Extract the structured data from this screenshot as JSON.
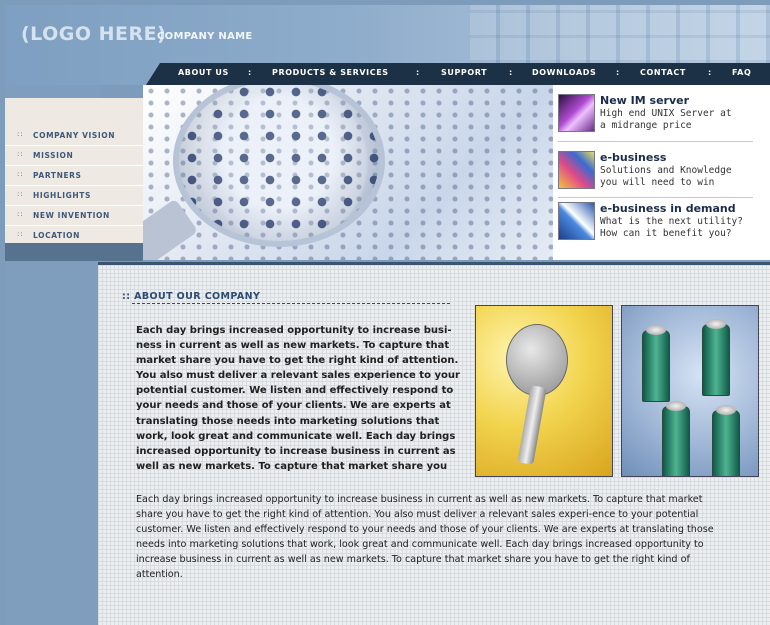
{
  "header": {
    "logo": "(LOGO HERE)",
    "company_name": "COMPANY NAME"
  },
  "nav": {
    "items": [
      {
        "label": "ABOUT US"
      },
      {
        "label": "PRODUCTS & SERVICES"
      },
      {
        "label": "SUPPORT"
      },
      {
        "label": "DOWNLOADS"
      },
      {
        "label": "CONTACT"
      },
      {
        "label": "FAQ"
      }
    ],
    "separator": ":"
  },
  "sidebar": {
    "bullet": "::",
    "items": [
      {
        "label": "COMPANY VISION"
      },
      {
        "label": "MISSION"
      },
      {
        "label": "PARTNERS"
      },
      {
        "label": "HIGHLIGHTS"
      },
      {
        "label": "NEW INVENTION"
      },
      {
        "label": "LOCATION"
      }
    ]
  },
  "promos": [
    {
      "title": "New IM   server",
      "desc": "High end UNIX Server at\na midrange price",
      "icon": "server-thumbnail"
    },
    {
      "title": "e-business",
      "desc": "Solutions and Knowledge\nyou will need to win",
      "icon": "ebusiness-thumbnail"
    },
    {
      "title": "e-business in demand",
      "desc": "What is the next utility?\nHow can it benefit you?",
      "icon": "demand-thumbnail"
    }
  ],
  "content": {
    "title": ":: ABOUT OUR COMPANY",
    "para1": "Each day brings increased opportunity to increase busi-ness in current as well as new markets. To capture that market share you have to get the right kind of attention. You also must deliver a relevant sales experience to your potential customer. We listen and effectively respond to your needs and those of your clients. We are experts at translating those needs into marketing solutions that work, look great and communicate well. Each day brings increased opportunity to increase business in current as well as new markets. To capture that market share you",
    "para2": "Each day brings increased opportunity to increase business in current as well as new markets. To capture that market share you have to get the right kind of attention. You also must deliver a relevant sales experi-ence to your potential customer. We listen and effectively respond to your needs and those of your clients. We are experts at translating those needs into marketing solutions that work, look great and communicate well. Each day brings increased opportunity to increase business in current as well as new markets. To capture that market share you have to get the right kind of attention."
  },
  "colors": {
    "nav_bg": "#1d3146",
    "header_blue": "#7e9fc1",
    "sidebar_bg": "#efe9e4",
    "title_blue": "#2c4a72"
  }
}
